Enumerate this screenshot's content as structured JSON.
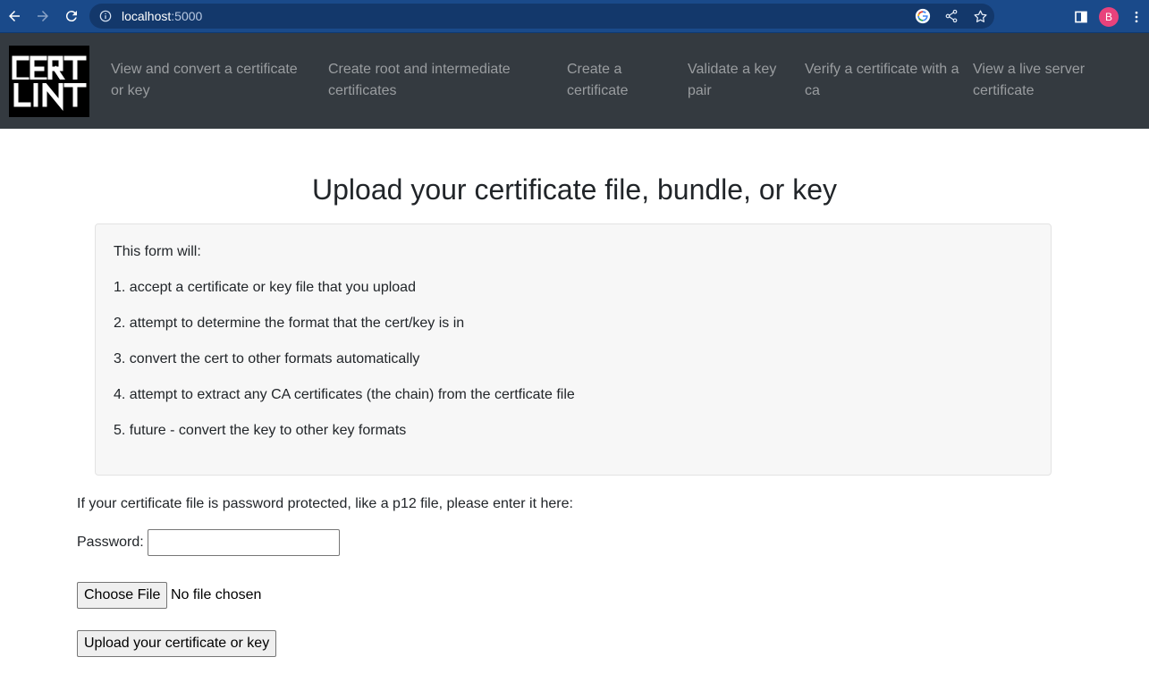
{
  "browser": {
    "url_host": "localhost",
    "url_port": ":5000",
    "avatar_initial": "B"
  },
  "navbar": {
    "logo_text": "CERT LINT",
    "links": [
      {
        "label": "View and convert a certificate or key"
      },
      {
        "label": "Create root and intermediate certificates"
      },
      {
        "label": "Create a certificate"
      },
      {
        "label": "Validate a key pair"
      },
      {
        "label": "Verify a certificate with a ca"
      },
      {
        "label": "View a live server certificate"
      }
    ]
  },
  "main": {
    "title": "Upload your certificate file, bundle, or key",
    "info": {
      "intro": "This form will:",
      "items": [
        "1. accept a certificate or key file that you upload",
        "2. attempt to determine the format that the cert/key is in",
        "3. convert the cert to other formats automatically",
        "4. attempt to extract any CA certificates (the chain) from the certficate file",
        "5. future - convert the key to other key formats"
      ]
    },
    "form": {
      "password_note": "If your certificate file is password protected, like a p12 file, please enter it here:",
      "password_label": "Password:",
      "password_value": "",
      "choose_file_label": "Choose File",
      "file_status": "No file chosen",
      "upload_label": "Upload your certificate or key"
    }
  },
  "colors": {
    "browser_bar": "#1a4a8a",
    "navbar_bg": "#343a40",
    "nav_link": "#9a9da0",
    "info_box_bg": "#f7f7f7",
    "avatar": "#e8427c"
  }
}
